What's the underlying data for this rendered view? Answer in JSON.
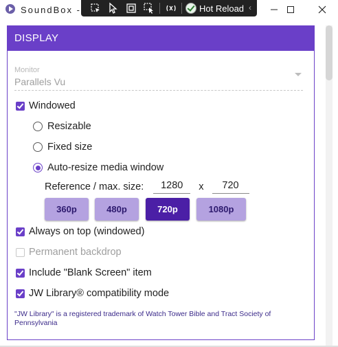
{
  "window": {
    "title": "SoundBox - (",
    "devtools": {
      "hot_reload_label": "Hot Reload"
    }
  },
  "display": {
    "header": "DISPLAY",
    "monitor": {
      "label": "Monitor",
      "value": "Parallels Vu"
    },
    "windowed": {
      "label": "Windowed",
      "checked": true
    },
    "resize_options": [
      {
        "label": "Resizable",
        "selected": false
      },
      {
        "label": "Fixed size",
        "selected": false
      },
      {
        "label": "Auto-resize media window",
        "selected": true
      }
    ],
    "reference": {
      "label": "Reference / max. size:",
      "width": "1280",
      "separator": "x",
      "height": "720"
    },
    "resolutions": [
      {
        "label": "360p",
        "active": false
      },
      {
        "label": "480p",
        "active": false
      },
      {
        "label": "720p",
        "active": true
      },
      {
        "label": "1080p",
        "active": false
      }
    ],
    "always_on_top": {
      "label": "Always on top (windowed)",
      "checked": true
    },
    "permanent_backdrop": {
      "label": "Permanent backdrop",
      "checked": false,
      "disabled": true
    },
    "blank_screen": {
      "label": "Include \"Blank Screen\" item",
      "checked": true
    },
    "jw_library": {
      "label": "JW Library® compatibility mode",
      "checked": true
    },
    "trademark_note": "\"JW Library\" is a registered trademark of Watch Tower Bible and Tract Society of Pennsylvania"
  },
  "colors": {
    "accent": "#6a3fc8",
    "button_light": "#b4a2e0",
    "button_active": "#4b1fa6"
  }
}
